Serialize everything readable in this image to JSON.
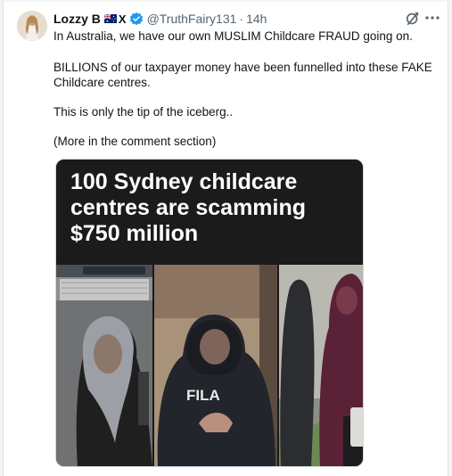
{
  "author": {
    "name": "Lozzy B",
    "x_badge": "X",
    "handle": "@TruthFairy131",
    "separator": "·",
    "time": "14h"
  },
  "icons": {
    "flag": "australia-flag-icon",
    "verified": "verified-badge-icon",
    "grok": "grok-icon",
    "more": "more-options-icon"
  },
  "colors": {
    "verified_blue": "#1d9bf0",
    "secondary_text": "#536471",
    "banner_background": "#1b1b1b"
  },
  "tweet": {
    "line1": "In Australia, we have our own MUSLIM  Childcare FRAUD going on.",
    "para2": "BILLIONS of our taxpayer money have been funnelled into these FAKE Childcare centres.",
    "para3": "This is only the tip of the iceberg..",
    "para4": "(More in the comment section)"
  },
  "media": {
    "headline": "100 Sydney childcare centres are scamming $750 million",
    "shirt_text": "FILA"
  }
}
